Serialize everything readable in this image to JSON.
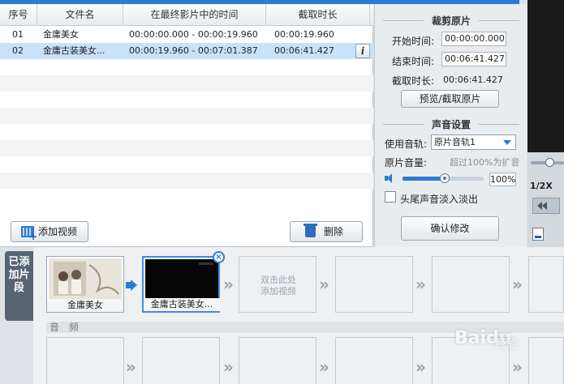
{
  "clip_list": {
    "headers": [
      "序号",
      "文件名",
      "在最终影片中的时间",
      "截取时长"
    ],
    "rows": [
      {
        "index": "01",
        "name": "金庸美女",
        "time_range": "00:00:00.000 - 00:00:19.960",
        "duration": "00:00:19.960",
        "selected": false
      },
      {
        "index": "02",
        "name": "金庸古装美女...",
        "time_range": "00:00:19.960 - 00:07:01.387",
        "duration": "00:06:41.427",
        "selected": true
      }
    ],
    "info_label": "i",
    "add_video_label": "添加视频",
    "delete_label": "删除"
  },
  "trim": {
    "title": "裁剪原片",
    "start_label": "开始时间:",
    "start_value": "00:00:00.000",
    "end_label": "结束时间:",
    "end_value": "00:06:41.427",
    "duration_label": "截取时长:",
    "duration_value": "00:06:41.427",
    "preview_button": "预览/截取原片"
  },
  "audio": {
    "title": "声音设置",
    "track_label": "使用音轨:",
    "track_value": "原片音轨1",
    "volume_label": "原片音量:",
    "volume_hint": "超过100%为扩音",
    "volume_value": "100%",
    "volume_level": 0.52,
    "fade_label": "头尾声音淡入淡出",
    "fade_checked": false,
    "confirm_button": "确认修改"
  },
  "right_strip": {
    "zoom_label": "1/2X"
  },
  "timeline": {
    "side_tab": "已添加片段",
    "clips": [
      {
        "caption": "金庸美女"
      },
      {
        "caption": "金庸古装美女..."
      }
    ],
    "add_hint": "双击此处\n添加视频",
    "close_label": "×",
    "audio_label": "音 频"
  },
  "watermark": {
    "text": "Baidu",
    "sub": "经验"
  },
  "colors": {
    "accent": "#2a7bd5",
    "selection": "#c8e2fa"
  }
}
